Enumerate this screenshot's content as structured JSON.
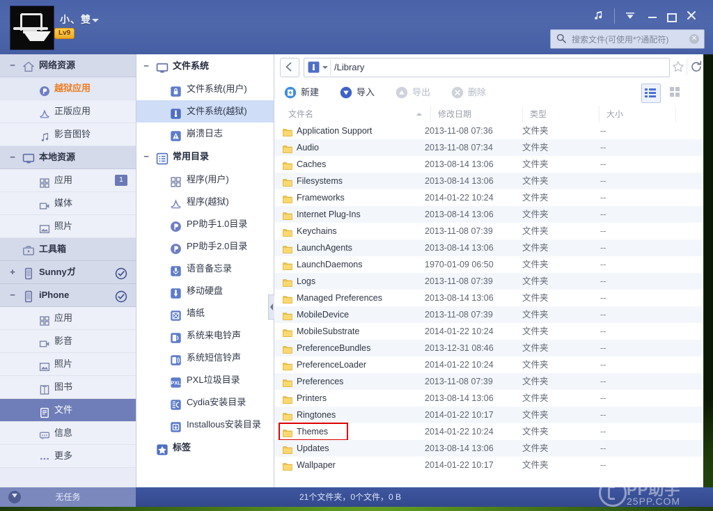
{
  "titlebar": {
    "username": "小、雙",
    "level_badge": "Lv9",
    "avatar_name": "user-avatar",
    "buttons": {
      "music": "♫",
      "menu": "▼",
      "minimize": "—",
      "maximize": "□",
      "close": "✕"
    }
  },
  "search": {
    "placeholder": "搜索文件(可使用*?通配符)",
    "value": ""
  },
  "sidebar": {
    "sections": [
      {
        "label": "网络资源",
        "icon": "home-icon",
        "twist": "−",
        "check": "",
        "items": [
          {
            "label": "越狱应用",
            "icon": "pp-icon",
            "state": "active",
            "badge": ""
          },
          {
            "label": "正版应用",
            "icon": "appstore-icon",
            "state": "",
            "badge": ""
          },
          {
            "label": "影音图铃",
            "icon": "music-note-icon",
            "state": "",
            "badge": ""
          }
        ]
      },
      {
        "label": "本地资源",
        "icon": "monitor-icon",
        "twist": "−",
        "check": "",
        "items": [
          {
            "label": "应用",
            "icon": "grid-icon",
            "state": "",
            "badge": "1"
          },
          {
            "label": "媒体",
            "icon": "video-icon",
            "state": "",
            "badge": ""
          },
          {
            "label": "照片",
            "icon": "photo-icon",
            "state": "",
            "badge": ""
          }
        ]
      },
      {
        "label": "工具箱",
        "icon": "toolbox-icon",
        "twist": "",
        "check": "",
        "items": []
      },
      {
        "label": "Sunnyガ",
        "icon": "device-icon",
        "twist": "+",
        "check": "check-circle-icon",
        "items": []
      },
      {
        "label": "iPhone",
        "icon": "device-icon",
        "twist": "−",
        "check": "check-circle-icon",
        "items": [
          {
            "label": "应用",
            "icon": "grid-icon",
            "state": "",
            "badge": ""
          },
          {
            "label": "影音",
            "icon": "video-icon",
            "state": "",
            "badge": ""
          },
          {
            "label": "照片",
            "icon": "photo-icon",
            "state": "",
            "badge": ""
          },
          {
            "label": "图书",
            "icon": "book-icon",
            "state": "",
            "badge": ""
          },
          {
            "label": "文件",
            "icon": "file-icon",
            "state": "selected",
            "badge": ""
          },
          {
            "label": "信息",
            "icon": "message-icon",
            "state": "",
            "badge": ""
          },
          {
            "label": "更多",
            "icon": "ellipsis-icon",
            "state": "",
            "badge": ""
          }
        ]
      }
    ]
  },
  "tree": {
    "groups": [
      {
        "label": "文件系统",
        "icon": "monitor-icon",
        "twist": "−",
        "items": [
          {
            "label": "文件系统(用户)",
            "icon": "lock-folder-icon",
            "state": ""
          },
          {
            "label": "文件系统(越狱)",
            "icon": "jailbreak-folder-icon",
            "state": "selected"
          },
          {
            "label": "崩溃日志",
            "icon": "warning-icon",
            "state": ""
          }
        ]
      },
      {
        "label": "常用目录",
        "icon": "list-icon",
        "twist": "−",
        "items": [
          {
            "label": "程序(用户)",
            "icon": "grid-icon",
            "state": ""
          },
          {
            "label": "程序(越狱)",
            "icon": "appstore-icon",
            "state": ""
          },
          {
            "label": "PP助手1.0目录",
            "icon": "pp-icon",
            "state": ""
          },
          {
            "label": "PP助手2.0目录",
            "icon": "pp-icon",
            "state": ""
          },
          {
            "label": "语音备忘录",
            "icon": "mic-icon",
            "state": ""
          },
          {
            "label": "移动硬盘",
            "icon": "drive-icon",
            "state": ""
          },
          {
            "label": "墙纸",
            "icon": "wallpaper-icon",
            "state": ""
          },
          {
            "label": "系统来电铃声",
            "icon": "ringtone-icon",
            "state": ""
          },
          {
            "label": "系统短信铃声",
            "icon": "sms-tone-icon",
            "state": ""
          },
          {
            "label": "PXL垃圾目录",
            "icon": "pxl-icon",
            "state": ""
          },
          {
            "label": "Cydia安装目录",
            "icon": "cydia-icon",
            "state": ""
          },
          {
            "label": "Installous安装目录",
            "icon": "installous-icon",
            "state": ""
          }
        ]
      },
      {
        "label": "标签",
        "icon": "star-icon",
        "twist": "",
        "items": []
      }
    ]
  },
  "addressbar": {
    "back_icon": "back-arrow-icon",
    "path_icon": "jailbreak-folder-icon",
    "path": "/Library",
    "star_icon": "star-outline-icon",
    "reload_icon": "reload-icon"
  },
  "toolbar": {
    "new_label": "新建",
    "import_label": "导入",
    "export_label": "导出",
    "delete_label": "删除",
    "view_list": "list-view-icon",
    "view_grid": "grid-view-icon"
  },
  "columns": {
    "name": "文件名",
    "date": "修改日期",
    "type": "类型",
    "size": "大小"
  },
  "files": [
    {
      "name": "Application Support",
      "date": "2013-11-08 07:36",
      "type": "文件夹",
      "size": "--"
    },
    {
      "name": "Audio",
      "date": "2013-11-08 07:34",
      "type": "文件夹",
      "size": "--"
    },
    {
      "name": "Caches",
      "date": "2013-08-14 13:06",
      "type": "文件夹",
      "size": "--"
    },
    {
      "name": "Filesystems",
      "date": "2013-08-14 13:06",
      "type": "文件夹",
      "size": "--"
    },
    {
      "name": "Frameworks",
      "date": "2014-01-22 10:24",
      "type": "文件夹",
      "size": "--"
    },
    {
      "name": "Internet Plug-Ins",
      "date": "2013-08-14 13:06",
      "type": "文件夹",
      "size": "--"
    },
    {
      "name": "Keychains",
      "date": "2013-11-08 07:39",
      "type": "文件夹",
      "size": "--"
    },
    {
      "name": "LaunchAgents",
      "date": "2013-08-14 13:06",
      "type": "文件夹",
      "size": "--"
    },
    {
      "name": "LaunchDaemons",
      "date": "1970-01-09 06:50",
      "type": "文件夹",
      "size": "--"
    },
    {
      "name": "Logs",
      "date": "2013-11-08 07:39",
      "type": "文件夹",
      "size": "--"
    },
    {
      "name": "Managed Preferences",
      "date": "2013-08-14 13:06",
      "type": "文件夹",
      "size": "--"
    },
    {
      "name": "MobileDevice",
      "date": "2013-11-08 07:39",
      "type": "文件夹",
      "size": "--"
    },
    {
      "name": "MobileSubstrate",
      "date": "2014-01-22 10:24",
      "type": "文件夹",
      "size": "--"
    },
    {
      "name": "PreferenceBundles",
      "date": "2013-12-31 08:46",
      "type": "文件夹",
      "size": "--"
    },
    {
      "name": "PreferenceLoader",
      "date": "2014-01-22 10:24",
      "type": "文件夹",
      "size": "--"
    },
    {
      "name": "Preferences",
      "date": "2013-11-08 07:39",
      "type": "文件夹",
      "size": "--"
    },
    {
      "name": "Printers",
      "date": "2013-08-14 13:06",
      "type": "文件夹",
      "size": "--"
    },
    {
      "name": "Ringtones",
      "date": "2014-01-22 10:17",
      "type": "文件夹",
      "size": "--"
    },
    {
      "name": "Themes",
      "date": "2014-01-22 10:24",
      "type": "文件夹",
      "size": "--",
      "highlight": true
    },
    {
      "name": "Updates",
      "date": "2013-08-14 13:06",
      "type": "文件夹",
      "size": "--"
    },
    {
      "name": "Wallpaper",
      "date": "2014-01-22 10:17",
      "type": "文件夹",
      "size": "--"
    }
  ],
  "statusbar": {
    "left": "无任务",
    "main": "21个文件夹，0个文件，0 B"
  },
  "watermark": {
    "top": "PP助手",
    "bottom": "25PP.COM"
  },
  "colors": {
    "accent_orange": "#ef7d22",
    "title_blue": "#4b63a9",
    "selection_blue": "#6f7eb8",
    "tree_selection": "#cfddf7",
    "highlight_red": "#e00000",
    "folder_yellow": "#f5c851"
  }
}
